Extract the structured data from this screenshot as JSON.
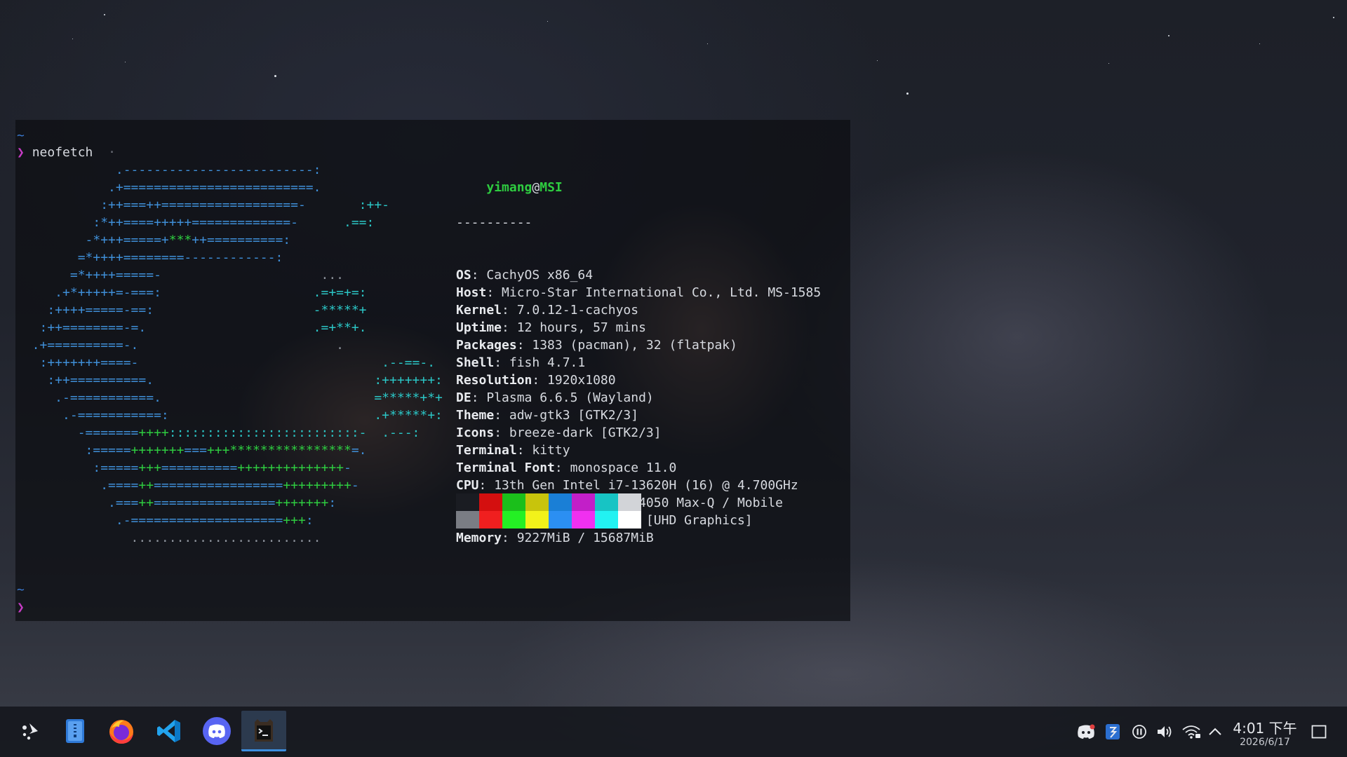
{
  "terminal": {
    "prompt_symbol": "❯",
    "tilde": "~",
    "command": "neofetch",
    "cursor_mark": "·",
    "ascii_art": [
      [
        {
          "t": "             .-------------------------:",
          "c": "blue"
        }
      ],
      [
        {
          "t": "            .+=========================.",
          "c": "blue"
        }
      ],
      [
        {
          "t": "           :++===++==================-       ",
          "c": "blue"
        },
        {
          "t": ":++-",
          "c": "cyan"
        }
      ],
      [
        {
          "t": "          :*++====+++++=============-      ",
          "c": "blue"
        },
        {
          "t": ".==:",
          "c": "cyan"
        }
      ],
      [
        {
          "t": "         -*+++=====+",
          "c": "blue"
        },
        {
          "t": "***",
          "c": "green"
        },
        {
          "t": "++==========:",
          "c": "blue"
        }
      ],
      [
        {
          "t": "        =*++++========------------:",
          "c": "blue"
        }
      ],
      [
        {
          "t": "       =*++++=====-                     ",
          "c": "blue"
        },
        {
          "t": "...",
          "c": "dim"
        }
      ],
      [
        {
          "t": "     .+*+++++=-===:                    ",
          "c": "blue"
        },
        {
          "t": ".=+=+=:",
          "c": "cyan"
        }
      ],
      [
        {
          "t": "    :++++=====-==:                     ",
          "c": "blue"
        },
        {
          "t": "-*****+",
          "c": "cyan"
        }
      ],
      [
        {
          "t": "   :++========-=.                      ",
          "c": "blue"
        },
        {
          "t": ".=+**+.",
          "c": "cyan"
        }
      ],
      [
        {
          "t": "  .+==========-.                          ",
          "c": "blue"
        },
        {
          "t": ".",
          "c": "dim"
        }
      ],
      [
        {
          "t": "   :+++++++====-                                ",
          "c": "blue"
        },
        {
          "t": ".--==-.",
          "c": "cyan"
        }
      ],
      [
        {
          "t": "    :++==========.                             ",
          "c": "blue"
        },
        {
          "t": ":+++++++:",
          "c": "cyan"
        }
      ],
      [
        {
          "t": "     .-===========.                            ",
          "c": "blue"
        },
        {
          "t": "=*****+*+",
          "c": "cyan"
        }
      ],
      [
        {
          "t": "      .-===========:                           ",
          "c": "blue"
        },
        {
          "t": ".+*****+:",
          "c": "cyan"
        }
      ],
      [
        {
          "t": "        -=======",
          "c": "blue"
        },
        {
          "t": "++++",
          "c": "green"
        },
        {
          "t": ":::::::::::::::::::::::::-  ",
          "c": "cyan"
        },
        {
          "t": ".---:",
          "c": "cyan"
        }
      ],
      [
        {
          "t": "         :=====",
          "c": "blue"
        },
        {
          "t": "+++++++",
          "c": "green"
        },
        {
          "t": "===",
          "c": "blue"
        },
        {
          "t": "+++****************",
          "c": "green"
        },
        {
          "t": "=.",
          "c": "blue"
        }
      ],
      [
        {
          "t": "          :=====",
          "c": "blue"
        },
        {
          "t": "+++",
          "c": "green"
        },
        {
          "t": "==========",
          "c": "blue"
        },
        {
          "t": "++++++++++++++",
          "c": "green"
        },
        {
          "t": "-",
          "c": "blue"
        }
      ],
      [
        {
          "t": "           .====",
          "c": "blue"
        },
        {
          "t": "++",
          "c": "green"
        },
        {
          "t": "=================",
          "c": "blue"
        },
        {
          "t": "+++++++++",
          "c": "green"
        },
        {
          "t": "-",
          "c": "blue"
        }
      ],
      [
        {
          "t": "            .===",
          "c": "blue"
        },
        {
          "t": "++",
          "c": "green"
        },
        {
          "t": "================",
          "c": "blue"
        },
        {
          "t": "+++++++",
          "c": "green"
        },
        {
          "t": ":",
          "c": "blue"
        }
      ],
      [
        {
          "t": "             .-====================",
          "c": "blue"
        },
        {
          "t": "+++",
          "c": "green"
        },
        {
          "t": ":",
          "c": "blue"
        }
      ],
      [
        {
          "t": "               .........................",
          "c": "dim"
        }
      ]
    ],
    "neofetch": {
      "user": "yimang",
      "at": "@",
      "host": "MSI",
      "separator": "----------",
      "rows": [
        {
          "key": "OS",
          "value": ": CachyOS x86_64"
        },
        {
          "key": "Host",
          "value": ": Micro-Star International Co., Ltd. MS-1585"
        },
        {
          "key": "Kernel",
          "value": ": 7.0.12-1-cachyos"
        },
        {
          "key": "Uptime",
          "value": ": 12 hours, 57 mins"
        },
        {
          "key": "Packages",
          "value": ": 1383 (pacman), 32 (flatpak)"
        },
        {
          "key": "Shell",
          "value": ": fish 4.7.1"
        },
        {
          "key": "Resolution",
          "value": ": 1920x1080"
        },
        {
          "key": "DE",
          "value": ": Plasma 6.6.5 (Wayland)"
        },
        {
          "key": "Theme",
          "value": ": adw-gtk3 [GTK2/3]"
        },
        {
          "key": "Icons",
          "value": ": breeze-dark [GTK2/3]"
        },
        {
          "key": "Terminal",
          "value": ": kitty"
        },
        {
          "key": "Terminal Font",
          "value": ": monospace 11.0"
        },
        {
          "key": "CPU",
          "value": ": 13th Gen Intel i7-13620H (16) @ 4.700GHz"
        },
        {
          "key": "GPU",
          "value": ": NVIDIA GeForce RTX 4050 Max-Q / Mobile"
        },
        {
          "key": "GPU",
          "value": ": Intel Raptor Lake-P [UHD Graphics]"
        },
        {
          "key": "Memory",
          "value": ": 9227MiB / 15687MiB"
        }
      ],
      "palette_top": [
        "#1a1c22",
        "#d40f0f",
        "#1bbf1b",
        "#c8c40c",
        "#1a7fd6",
        "#c21fc8",
        "#17c4c4",
        "#d2d4d8"
      ],
      "palette_bottom": [
        "#7a7d84",
        "#f01f1f",
        "#24f024",
        "#f2f21a",
        "#2b8ff2",
        "#f030f0",
        "#22f2f2",
        "#ffffff"
      ]
    }
  },
  "taskbar": {
    "apps": [
      {
        "name": "application-launcher-icon",
        "active": false
      },
      {
        "name": "file-manager-icon",
        "active": false
      },
      {
        "name": "firefox-icon",
        "active": false
      },
      {
        "name": "vscode-icon",
        "active": false
      },
      {
        "name": "discord-icon",
        "active": false
      },
      {
        "name": "terminal-icon",
        "active": true
      }
    ],
    "tray": [
      "discord-tray-icon",
      "clipboard-tray-icon",
      "media-pause-icon",
      "volume-icon",
      "wifi-icon",
      "chevron-up-icon"
    ],
    "clock": {
      "time": "4:01 下午",
      "date": "2026/6/17"
    },
    "show_desktop": "show-desktop-icon",
    "accent": "#3d8fe0"
  }
}
